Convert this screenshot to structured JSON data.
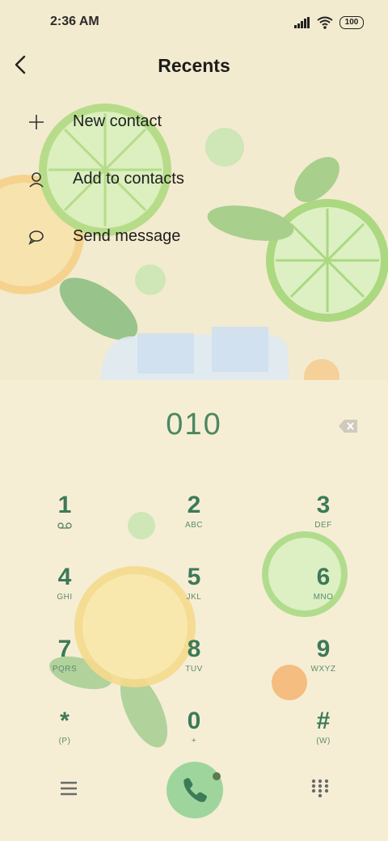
{
  "status_bar": {
    "time": "2:36 AM",
    "battery": "100"
  },
  "header": {
    "title": "Recents"
  },
  "menu": [
    {
      "label": "New contact",
      "icon": "plus-icon"
    },
    {
      "label": "Add to contacts",
      "icon": "person-icon"
    },
    {
      "label": "Send message",
      "icon": "chat-bubble-icon"
    }
  ],
  "dialer": {
    "number": "010",
    "keys": [
      {
        "digit": "1",
        "letters": "voicemail-icon"
      },
      {
        "digit": "2",
        "letters": "ABC"
      },
      {
        "digit": "3",
        "letters": "DEF"
      },
      {
        "digit": "4",
        "letters": "GHI"
      },
      {
        "digit": "5",
        "letters": "JKL"
      },
      {
        "digit": "6",
        "letters": "MNO"
      },
      {
        "digit": "7",
        "letters": "PQRS"
      },
      {
        "digit": "8",
        "letters": "TUV"
      },
      {
        "digit": "9",
        "letters": "WXYZ"
      },
      {
        "digit": "*",
        "letters": "(P)"
      },
      {
        "digit": "0",
        "letters": "+"
      },
      {
        "digit": "#",
        "letters": "(W)"
      }
    ]
  },
  "colors": {
    "accent": "#3d7a57",
    "call_button": "#9ed59d",
    "background": "#f5eed5"
  }
}
